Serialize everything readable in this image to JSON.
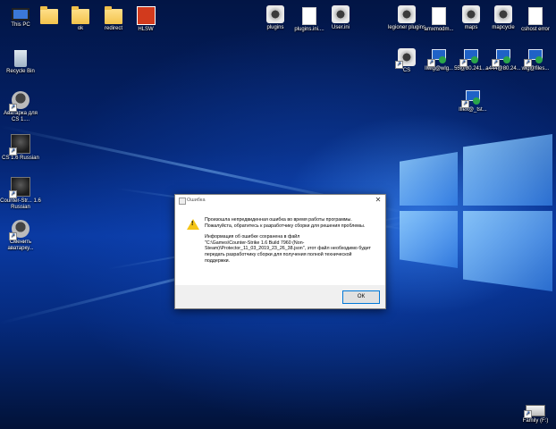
{
  "desktop": {
    "icons": [
      {
        "label": "This PC",
        "icon": "computer-icon"
      },
      {
        "label": "",
        "icon": "folder-icon"
      },
      {
        "label": "ok",
        "icon": "folder-icon"
      },
      {
        "label": "redirect",
        "icon": "folder-icon"
      },
      {
        "label": "HLSW",
        "icon": "hlsw-icon"
      },
      {
        "label": "plugins",
        "icon": "settings-file-icon"
      },
      {
        "label": "plugins.ini....",
        "icon": "text-file-icon"
      },
      {
        "label": "User.ini",
        "icon": "settings-file-icon"
      },
      {
        "label": "legioner plugins",
        "icon": "settings-file-icon"
      },
      {
        "label": "amxmodm...",
        "icon": "text-file-icon"
      },
      {
        "label": "maps",
        "icon": "settings-file-icon"
      },
      {
        "label": "mapcycle",
        "icon": "settings-file-icon"
      },
      {
        "label": "cshost error",
        "icon": "text-file-icon"
      },
      {
        "label": "Recycle Bin",
        "icon": "recycle-bin-icon"
      },
      {
        "label": "CS",
        "icon": "settings-file-icon"
      },
      {
        "label": "Ilwlg@wlg...",
        "icon": "network-shortcut-icon"
      },
      {
        "label": "55@80.241....",
        "icon": "network-shortcut-icon"
      },
      {
        "label": "a444@80.24...",
        "icon": "network-shortcut-icon"
      },
      {
        "label": "wlg@files...",
        "icon": "network-shortcut-icon"
      },
      {
        "label": "lflex@_tst...",
        "icon": "network-shortcut-icon"
      },
      {
        "label": "Аватарка для CS 1....",
        "icon": "avatar-icon"
      },
      {
        "label": "CS 1.6 Russian",
        "icon": "counter-strike-icon"
      },
      {
        "label": "Counter-Str... 1.6 Russian",
        "icon": "counter-strike-icon"
      },
      {
        "label": "Сменить аватарку...",
        "icon": "avatar-icon"
      },
      {
        "label": "Family (F:)",
        "icon": "drive-icon"
      }
    ]
  },
  "dialog": {
    "title": "Ошибка",
    "close_glyph": "✕",
    "message_line1": "Произошла непредвиденная ошибка во время работы программы.",
    "message_line2": "Пожалуйста, обратитесь к разработчику сборки для решения проблемы.",
    "info_line1": "Информация об ошибке сохранена в файл",
    "info_line2": "\"C:\\Games\\Counter-Strike 1.6 Build 7960 (Non-Steam)\\Protector_11_03_2019_23_26_38.json\", этот файл необходимо будет передать разработчику сборки для получения полной технической поддержки.",
    "ok_label": "ОК"
  }
}
